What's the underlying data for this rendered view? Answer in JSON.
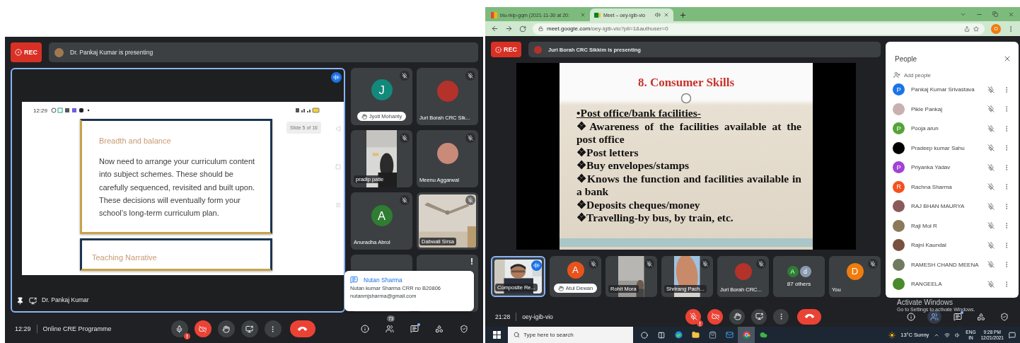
{
  "left": {
    "rec": "REC",
    "banner": "Dr. Pankaj Kumar is presenting",
    "stage": {
      "presenter": "Dr. Pankaj Kumar",
      "speaking": true,
      "phone_time": "12:29",
      "slide_counter": "Slide 5 of 16",
      "cards": [
        {
          "title": "Breadth and balance",
          "body": "Now need to arrange your curriculum content into subject schemes. These should be carefully sequenced, revisited and built upon. These decisions will eventually form your school’s long-term curriculum plan."
        },
        {
          "title": "Teaching Narrative"
        }
      ]
    },
    "tiles": [
      {
        "kind": "initial",
        "initial": "J",
        "color": "#12897b",
        "name": "Jyoti Mohanty",
        "hand_raised": true,
        "muted": true
      },
      {
        "color": "#b3322a",
        "name": "Juri Borah CRC Sik...",
        "hand_raised": false,
        "muted": true
      },
      {
        "kind": "video",
        "name": "pradip patle",
        "muted": true
      },
      {
        "color": "#c98a7a",
        "name": "Meenu Aggarwal",
        "muted": true
      },
      {
        "kind": "initial",
        "initial": "A",
        "color": "#2e7d32",
        "name": "Anuradha Abrol",
        "muted": true
      },
      {
        "kind": "video",
        "name": "Dabwali Sirsa",
        "muted": true
      },
      {
        "kind": "blank"
      },
      {
        "kind": "blank",
        "alert": "!"
      }
    ],
    "chat_toast": {
      "sender": "Nutan Sharma",
      "lines": [
        "Nutan kumar Sharma CRR no B20806",
        "nutanmjsharma@gmail.com"
      ]
    },
    "meeting_time": "12:29",
    "meeting_title": "Online CRE Programme",
    "controls": {
      "mic_on": true,
      "camera_on": false
    },
    "people_count": "73"
  },
  "right": {
    "tabs": [
      {
        "title": "biu-rkip-gqm (2021-11-30 at 20:",
        "selected": false,
        "playing_audio": false
      },
      {
        "title": "Meet – oey-igib-vio",
        "selected": true,
        "playing_audio": true
      }
    ],
    "url": "meet.google.com/oey-igib-vio?pli=1&authuser=0",
    "profile_initial": "O",
    "rec": "REC",
    "banner": "Juri Borah CRC Sikkim is presenting",
    "slide": {
      "title": "8. Consumer Skills",
      "items": [
        {
          "marker": "•",
          "text": "Post office/bank facilities-",
          "underlined": true
        },
        {
          "marker": "❖",
          "text": "Awareness of the facilities available at the post office",
          "underlined": false
        },
        {
          "marker": "❖",
          "text": "Post letters",
          "underlined": false
        },
        {
          "marker": "❖",
          "text": "Buy envelopes/stamps",
          "underlined": false
        },
        {
          "marker": "❖",
          "text": "Knows the function and facilities available in a bank",
          "underlined": false
        },
        {
          "marker": "❖",
          "text": "Deposits cheques/money",
          "underlined": false
        },
        {
          "marker": "❖",
          "text": "Travelling-by bus, by train, etc.",
          "underlined": false
        }
      ]
    },
    "tiles": [
      {
        "kind": "video",
        "name": "Composite Re...",
        "speaking": true
      },
      {
        "kind": "initial",
        "initial": "A",
        "color": "#e8531c",
        "name": "Atul Dewan",
        "hand_raised": true,
        "muted": true
      },
      {
        "kind": "video",
        "name": "Rohit Mora",
        "muted": true
      },
      {
        "kind": "video",
        "name": "Shrirang Pach...",
        "muted": true
      },
      {
        "color": "#b3322a",
        "name": "Juri Borah CRC...",
        "muted": true
      },
      {
        "kind": "others",
        "name": "87 others",
        "avatars": [
          {
            "initial": "A",
            "color": "#2e7d32"
          },
          {
            "initial": "d",
            "color": "#8a9bb0"
          }
        ]
      },
      {
        "kind": "initial",
        "initial": "D",
        "color": "#ef7c0e",
        "name": "You",
        "muted": true
      }
    ],
    "meeting_time": "21:28",
    "meeting_code": "oey-igib-vio",
    "controls": {
      "mic_on": false,
      "camera_on": false
    },
    "people_open": true,
    "people": {
      "title": "People",
      "add": "Add people",
      "list": [
        {
          "name": "Pankaj Kumar Srivastava",
          "kind": "initial",
          "initial": "P",
          "color": "#1a73e8",
          "muted": true
        },
        {
          "name": "Pikle Pankaj",
          "color": "#c9b0b0",
          "muted": true
        },
        {
          "name": "Pooja arun",
          "kind": "initial",
          "initial": "P",
          "color": "#56a33a",
          "muted": true
        },
        {
          "name": "Pradeep kumar Sahu",
          "color": "#000000",
          "muted": true
        },
        {
          "name": "Priyanka Yadav",
          "kind": "initial",
          "initial": "P",
          "color": "#a142d4",
          "muted": true
        },
        {
          "name": "Rachna Sharma",
          "kind": "initial",
          "initial": "R",
          "color": "#f4511e",
          "muted": true
        },
        {
          "name": "RAJ BHAN MAURYA",
          "color": "#8a5a5a",
          "muted": true
        },
        {
          "name": "Raji Mol R",
          "color": "#8a7a5a",
          "muted": true
        },
        {
          "name": "Rajni Kaundal",
          "color": "#7a5040",
          "muted": true
        },
        {
          "name": "RAMESH CHAND MEENA",
          "color": "#707a60",
          "muted": true
        },
        {
          "name": "RANGEELA",
          "color": "#4a8a2a",
          "muted": true
        }
      ]
    },
    "windows_notice": {
      "title": "Activate Windows",
      "subtitle": "Go to Settings to activate Windows."
    },
    "taskbar": {
      "search_placeholder": "Type here to search",
      "weather": "13°C Sunny",
      "language": "ENG",
      "region": "IN",
      "time": "9:28 PM",
      "date": "12/21/2021"
    }
  }
}
